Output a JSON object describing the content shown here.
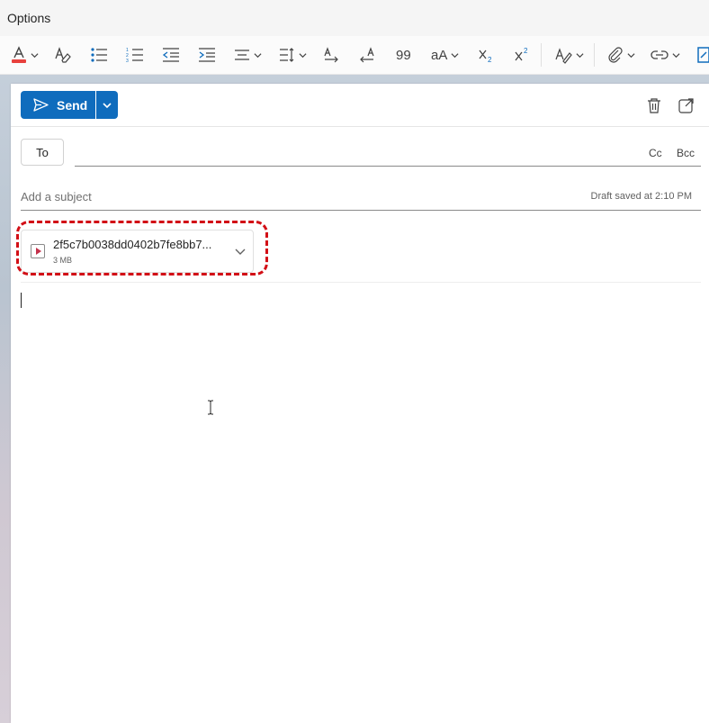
{
  "ribbon": {
    "tab_label": "Options"
  },
  "toolbar": {
    "icons": [
      "font-color-icon",
      "clear-formatting-icon",
      "bullets-icon",
      "numbering-icon",
      "decrease-indent-icon",
      "increase-indent-icon",
      "align-icon",
      "line-spacing-icon",
      "text-direction-ltr-icon",
      "text-direction-rtl-icon",
      "quote-icon",
      "change-case-icon",
      "subscript-icon",
      "superscript-icon",
      "styles-icon",
      "attach-icon",
      "link-icon",
      "editor-icon"
    ],
    "font_color": "#e8413d",
    "quote_label": "99",
    "case_label": "aA"
  },
  "compose": {
    "send_label": "Send",
    "to_label": "To",
    "cc_label": "Cc",
    "bcc_label": "Bcc",
    "subject_placeholder": "Add a subject",
    "draft_status": "Draft saved at 2:10 PM",
    "accent_color": "#0f6cbd"
  },
  "attachment": {
    "name": "2f5c7b0038dd0402b7fe8bb7...",
    "size": "3 MB",
    "icon": "video-file-icon",
    "highlight_color": "#d20f16"
  }
}
